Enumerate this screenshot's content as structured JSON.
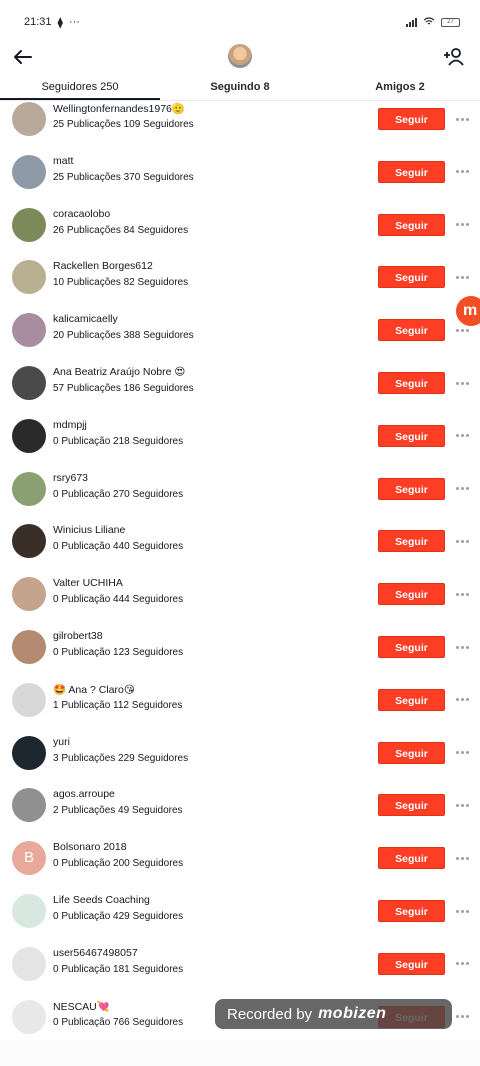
{
  "status_bar": {
    "time": "21:31",
    "battery": "27"
  },
  "header": {
    "back_icon": "arrow-left-icon",
    "add_user_icon": "add-user-icon"
  },
  "tabs": [
    {
      "label": "Seguidores 250",
      "active": true
    },
    {
      "label": "Seguindo 8",
      "active": false
    },
    {
      "label": "Amigos 2",
      "active": false
    }
  ],
  "follow_label": "Seguir",
  "users": [
    {
      "name": "Wellingtonfernandes1976🫡",
      "stats": "25 Publicações 109 Seguidores",
      "avatar_color": "#b9a99a"
    },
    {
      "name": "matt",
      "stats": "25 Publicações 370 Seguidores",
      "avatar_color": "#8f9aa8"
    },
    {
      "name": "coracaolobo",
      "stats": "26 Publicações 84 Seguidores",
      "avatar_color": "#7c8a5a"
    },
    {
      "name": "Rackellen Borges612",
      "stats": "10 Publicações 82 Seguidores",
      "avatar_color": "#b8b090"
    },
    {
      "name": "kalicamicaelly",
      "stats": "20 Publicações 388 Seguidores",
      "avatar_color": "#a88ca0"
    },
    {
      "name": "Ana Beatriz Araújo Nobre 😍",
      "stats": "57 Publicações 186 Seguidores",
      "avatar_color": "#4a4a4a"
    },
    {
      "name": "mdmpjj",
      "stats": "0 Publicação 218 Seguidores",
      "avatar_color": "#2a2a2a"
    },
    {
      "name": "rsry673",
      "stats": "0 Publicação 270 Seguidores",
      "avatar_color": "#8aa070"
    },
    {
      "name": "Winicius Liliane",
      "stats": "0 Publicação 440 Seguidores",
      "avatar_color": "#3a2e28"
    },
    {
      "name": "Valter UCHIHA",
      "stats": "0 Publicação 444 Seguidores",
      "avatar_color": "#c4a48c"
    },
    {
      "name": "gilrobert38",
      "stats": "0 Publicação 123 Seguidores",
      "avatar_color": "#b48a70"
    },
    {
      "name": "🤩 Ana ?  Claro😘",
      "stats": "1 Publicação 112 Seguidores",
      "avatar_color": "#d8d8d8"
    },
    {
      "name": "yuri",
      "stats": "3 Publicações 229 Seguidores",
      "avatar_color": "#1e2630"
    },
    {
      "name": "agos.arroupe",
      "stats": "2 Publicações 49 Seguidores",
      "avatar_color": "#909090"
    },
    {
      "name": "Bolsonaro 2018",
      "stats": "0 Publicação 200 Seguidores",
      "avatar_color": "#e8a99a",
      "initial": "B"
    },
    {
      "name": "Life Seeds Coaching",
      "stats": "0 Publicação 429 Seguidores",
      "avatar_color": "#d8e8e0"
    },
    {
      "name": "user56467498057",
      "stats": "0 Publicação 181 Seguidores",
      "avatar_color": "#e4e4e4"
    },
    {
      "name": "NESCAU💘",
      "stats": "0 Publicação 766 Seguidores",
      "avatar_color": "#e8e8e8"
    }
  ],
  "overlay": {
    "watermark_text": "Recorded by",
    "watermark_logo": "mobizen",
    "fab_letter": "m"
  },
  "colors": {
    "follow_button": "#fe3d25",
    "text": "#161823",
    "fab": "#f04e23"
  }
}
